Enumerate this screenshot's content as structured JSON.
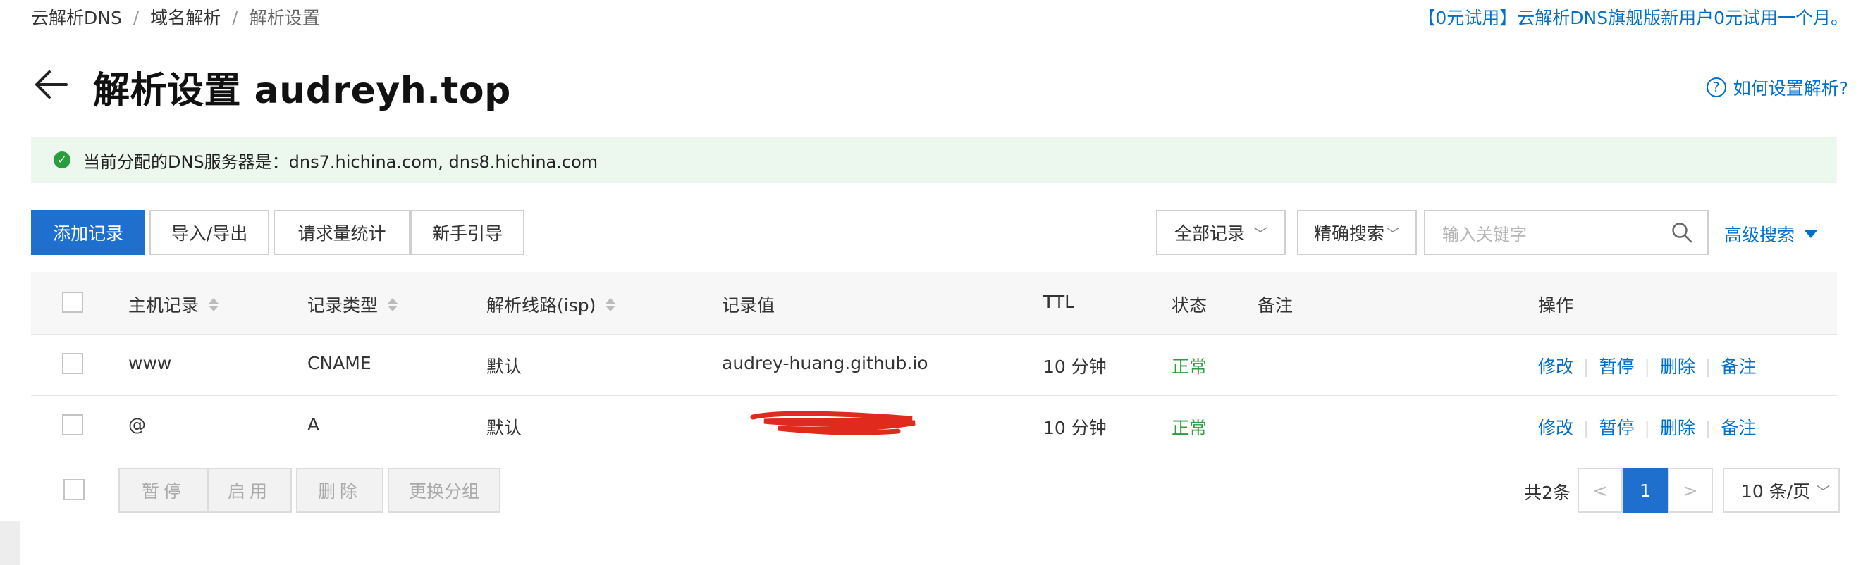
{
  "breadcrumb": {
    "items": [
      "云解析DNS",
      "域名解析",
      "解析设置"
    ]
  },
  "promo": "【0元试用】云解析DNS旗舰版新用户0元试用一个月。",
  "page": {
    "title": "解析设置 audreyh.top",
    "help_link": "如何设置解析?"
  },
  "notice": {
    "text": "当前分配的DNS服务器是：dns7.hichina.com, dns8.hichina.com"
  },
  "toolbar": {
    "add": "添加记录",
    "import_export": "导入/导出",
    "request_stats": "请求量统计",
    "guide": "新手引导",
    "filter_select": "全部记录",
    "search_mode": "精确搜索",
    "search_placeholder": "输入关键字",
    "advanced": "高级搜索"
  },
  "table": {
    "headers": {
      "host": "主机记录",
      "type": "记录类型",
      "line": "解析线路(isp)",
      "value": "记录值",
      "ttl": "TTL",
      "status": "状态",
      "remark": "备注",
      "ops": "操作"
    },
    "rows": [
      {
        "host": "www",
        "type": "CNAME",
        "line": "默认",
        "value": "audrey-huang.github.io",
        "ttl": "10 分钟",
        "status": "正常",
        "remark": ""
      },
      {
        "host": "@",
        "type": "A",
        "line": "默认",
        "value": "",
        "ttl": "10 分钟",
        "status": "正常",
        "remark": ""
      }
    ],
    "ops": {
      "edit": "修改",
      "pause": "暂停",
      "delete": "删除",
      "remark": "备注"
    }
  },
  "footer": {
    "pause": "暂停",
    "enable": "启用",
    "delete": "删除",
    "change_group": "更换分组",
    "total": "共2条",
    "page_prev": "<",
    "page_current": "1",
    "page_next": ">",
    "page_size": "10 条/页"
  },
  "colors": {
    "primary": "#1f6fcf",
    "link": "#0070cc",
    "success": "#2a9d3f",
    "notice_bg": "#ecf8ee"
  },
  "icons": [
    "back-arrow-icon",
    "help-icon",
    "check-circle-icon",
    "search-icon",
    "caret-down-icon",
    "sort-icon",
    "chevron-down-icon"
  ]
}
